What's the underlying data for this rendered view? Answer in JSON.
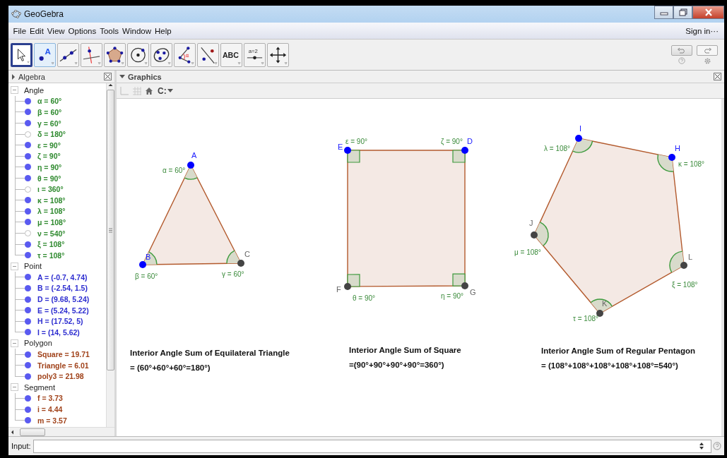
{
  "window": {
    "title": "GeoGebra"
  },
  "menu": [
    "File",
    "Edit",
    "View",
    "Options",
    "Tools",
    "Window",
    "Help"
  ],
  "sign_in": "Sign in···",
  "tools": [
    {
      "kind": "move",
      "selected": true,
      "hovered": false
    },
    {
      "kind": "point",
      "label": "A",
      "selected": false,
      "hovered": true
    },
    {
      "kind": "line",
      "selected": false,
      "hovered": false
    },
    {
      "kind": "perpendicular",
      "selected": false,
      "hovered": false
    },
    {
      "kind": "polygon",
      "selected": false,
      "hovered": false
    },
    {
      "kind": "circle",
      "selected": false,
      "hovered": false
    },
    {
      "kind": "conic",
      "selected": false,
      "hovered": false
    },
    {
      "kind": "angle",
      "label": "α",
      "selected": false,
      "hovered": false
    },
    {
      "kind": "reflect",
      "selected": false,
      "hovered": false
    },
    {
      "kind": "text",
      "label": "ABC",
      "selected": false,
      "hovered": false
    },
    {
      "kind": "slider",
      "label": "a=2",
      "selected": false,
      "hovered": false
    },
    {
      "kind": "move-view",
      "selected": false,
      "hovered": false
    }
  ],
  "algebra": {
    "title": "Algebra",
    "groups": [
      {
        "name": "Angle",
        "color": "#2f8a2f",
        "items": [
          {
            "text": "α = 60°",
            "visible": true
          },
          {
            "text": "β = 60°",
            "visible": true
          },
          {
            "text": "γ = 60°",
            "visible": true
          },
          {
            "text": "δ = 180°",
            "visible": false
          },
          {
            "text": "ε = 90°",
            "visible": true
          },
          {
            "text": "ζ = 90°",
            "visible": true
          },
          {
            "text": "η = 90°",
            "visible": true
          },
          {
            "text": "θ = 90°",
            "visible": true
          },
          {
            "text": "ι = 360°",
            "visible": false
          },
          {
            "text": "κ = 108°",
            "visible": true
          },
          {
            "text": "λ = 108°",
            "visible": true
          },
          {
            "text": "μ = 108°",
            "visible": true
          },
          {
            "text": "ν = 540°",
            "visible": false
          },
          {
            "text": "ξ = 108°",
            "visible": true
          },
          {
            "text": "τ = 108°",
            "visible": true
          }
        ]
      },
      {
        "name": "Point",
        "color": "#2d2dd0",
        "items": [
          {
            "text": "A = (-0.7, 4.74)",
            "visible": true
          },
          {
            "text": "B = (-2.54, 1.5)",
            "visible": true
          },
          {
            "text": "D = (9.68, 5.24)",
            "visible": true
          },
          {
            "text": "E = (5.24, 5.22)",
            "visible": true
          },
          {
            "text": "H = (17.52, 5)",
            "visible": true
          },
          {
            "text": "I = (14, 5.62)",
            "visible": true
          }
        ]
      },
      {
        "name": "Polygon",
        "color": "#a0421a",
        "items": [
          {
            "text": "Square = 19.71",
            "visible": true
          },
          {
            "text": "Triangle = 6.01",
            "visible": true
          },
          {
            "text": "poly3 = 21.98",
            "visible": true
          }
        ]
      },
      {
        "name": "Segment",
        "color": "#a0421a",
        "items": [
          {
            "text": "f = 3.73",
            "visible": true
          },
          {
            "text": "i = 4.44",
            "visible": true
          },
          {
            "text": "m = 3.57",
            "visible": true
          }
        ]
      }
    ]
  },
  "graphics": {
    "title": "Graphics",
    "capture_label": "C:",
    "figures": [
      {
        "kind": "triangle",
        "points": [
          {
            "label": "A",
            "color": "#0000ff",
            "angle": "α = 60°",
            "kind": "arc"
          },
          {
            "label": "B",
            "color": "#0000ff",
            "angle": "β = 60°",
            "kind": "arc"
          },
          {
            "label": "C",
            "color": "#444444",
            "angle": "γ = 60°",
            "kind": "arc"
          }
        ],
        "caption": [
          "Interior Angle Sum of Equilateral Triangle",
          "= (60°+60°+60°=180°)"
        ]
      },
      {
        "kind": "square",
        "points": [
          {
            "label": "E",
            "color": "#0000ff",
            "angle": "ε = 90°",
            "kind": "right"
          },
          {
            "label": "D",
            "color": "#0000ff",
            "angle": "ζ = 90°",
            "kind": "right"
          },
          {
            "label": "F",
            "color": "#444444",
            "angle": "θ = 90°",
            "kind": "right"
          },
          {
            "label": "G",
            "color": "#444444",
            "angle": "η = 90°",
            "kind": "right"
          }
        ],
        "caption": [
          "Interior Angle Sum of Square",
          "=(90°+90°+90°+90°=360°)"
        ]
      },
      {
        "kind": "pentagon",
        "points": [
          {
            "label": "I",
            "color": "#0000ff",
            "angle": "λ = 108°",
            "kind": "arc"
          },
          {
            "label": "H",
            "color": "#0000ff",
            "angle": "κ = 108°",
            "kind": "arc"
          },
          {
            "label": "L",
            "color": "#444444",
            "angle": "ξ = 108°",
            "kind": "arc"
          },
          {
            "label": "K",
            "color": "#444444",
            "angle": "τ = 108°",
            "kind": "arc"
          },
          {
            "label": "J",
            "color": "#444444",
            "angle": "μ = 108°",
            "kind": "arc"
          }
        ],
        "caption": [
          "Interior Angle Sum of Regular Pentagon",
          "= (108°+108°+108°+108°+108°=540°)"
        ]
      }
    ]
  },
  "input": {
    "label": "Input:"
  }
}
